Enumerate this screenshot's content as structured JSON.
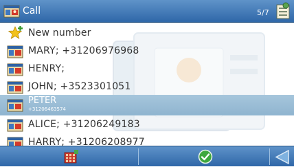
{
  "window": {
    "title": "Call",
    "counter": "5/7"
  },
  "list": {
    "new_number_label": "New number",
    "contacts": [
      {
        "text": "MARY;  +31206976968"
      },
      {
        "text": "HENRY;"
      },
      {
        "text": "JOHN;  +3523301051"
      },
      {
        "name": "PETER",
        "number": "+31206463574",
        "selected": true
      },
      {
        "text": "ALICE;  +31206249183"
      },
      {
        "text": "HARRY;  +31206208977"
      }
    ]
  },
  "icons": {
    "app": "contact-card-icon",
    "mode": "settings-list-icon",
    "new": "star-plus-icon",
    "contact": "contact-card-icon",
    "bottom_left": "keypad-icon",
    "bottom_center": "checkmark-icon",
    "bottom_right": "back-arrow-icon"
  },
  "colors": {
    "bar_top": "#5f93c9",
    "bar_bottom": "#2f67a8",
    "selection": "#9dbdd5",
    "confirm_green": "#3ea83e"
  }
}
